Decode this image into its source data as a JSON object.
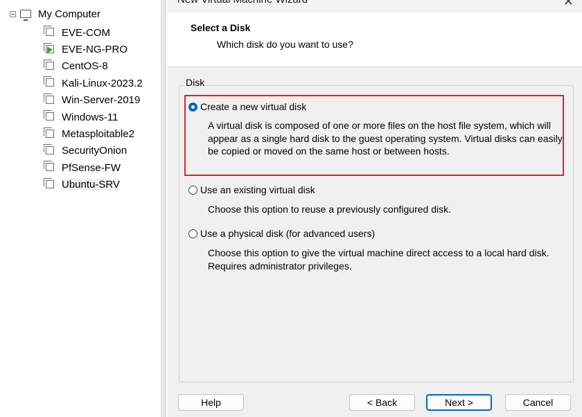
{
  "library": {
    "root_label": "My Computer",
    "items": [
      {
        "label": "EVE-COM",
        "running": false
      },
      {
        "label": "EVE-NG-PRO",
        "running": true
      },
      {
        "label": "CentOS-8",
        "running": false
      },
      {
        "label": "Kali-Linux-2023.2",
        "running": false
      },
      {
        "label": "Win-Server-2019",
        "running": false
      },
      {
        "label": "Windows-11",
        "running": false
      },
      {
        "label": "Metasploitable2",
        "running": false
      },
      {
        "label": "SecurityOnion",
        "running": false
      },
      {
        "label": "PfSense-FW",
        "running": false
      },
      {
        "label": "Ubuntu-SRV",
        "running": false
      }
    ],
    "selected_index": 9
  },
  "wizard": {
    "title": "New Virtual Machine Wizard",
    "close_glyph": "✕",
    "header_title": "Select a Disk",
    "header_subtitle": "Which disk do you want to use?",
    "group_label": "Disk",
    "options": [
      {
        "label": "Create a new virtual disk",
        "selected": true,
        "description": "A virtual disk is composed of one or more files on the host file system, which will appear as a single hard disk to the guest operating system. Virtual disks can easily be copied or moved on the same host or between hosts."
      },
      {
        "label": "Use an existing virtual disk",
        "selected": false,
        "description": "Choose this option to reuse a previously configured disk."
      },
      {
        "label": "Use a physical disk (for advanced users)",
        "selected": false,
        "description": "Choose this option to give the virtual machine direct access to a local hard disk. Requires administrator privileges."
      }
    ],
    "buttons": {
      "help": "Help",
      "back": "< Back",
      "next": "Next >",
      "cancel": "Cancel"
    }
  },
  "colors": {
    "accent": "#0067c0",
    "highlight_box": "#e0202a",
    "running_play": "#27a427"
  }
}
